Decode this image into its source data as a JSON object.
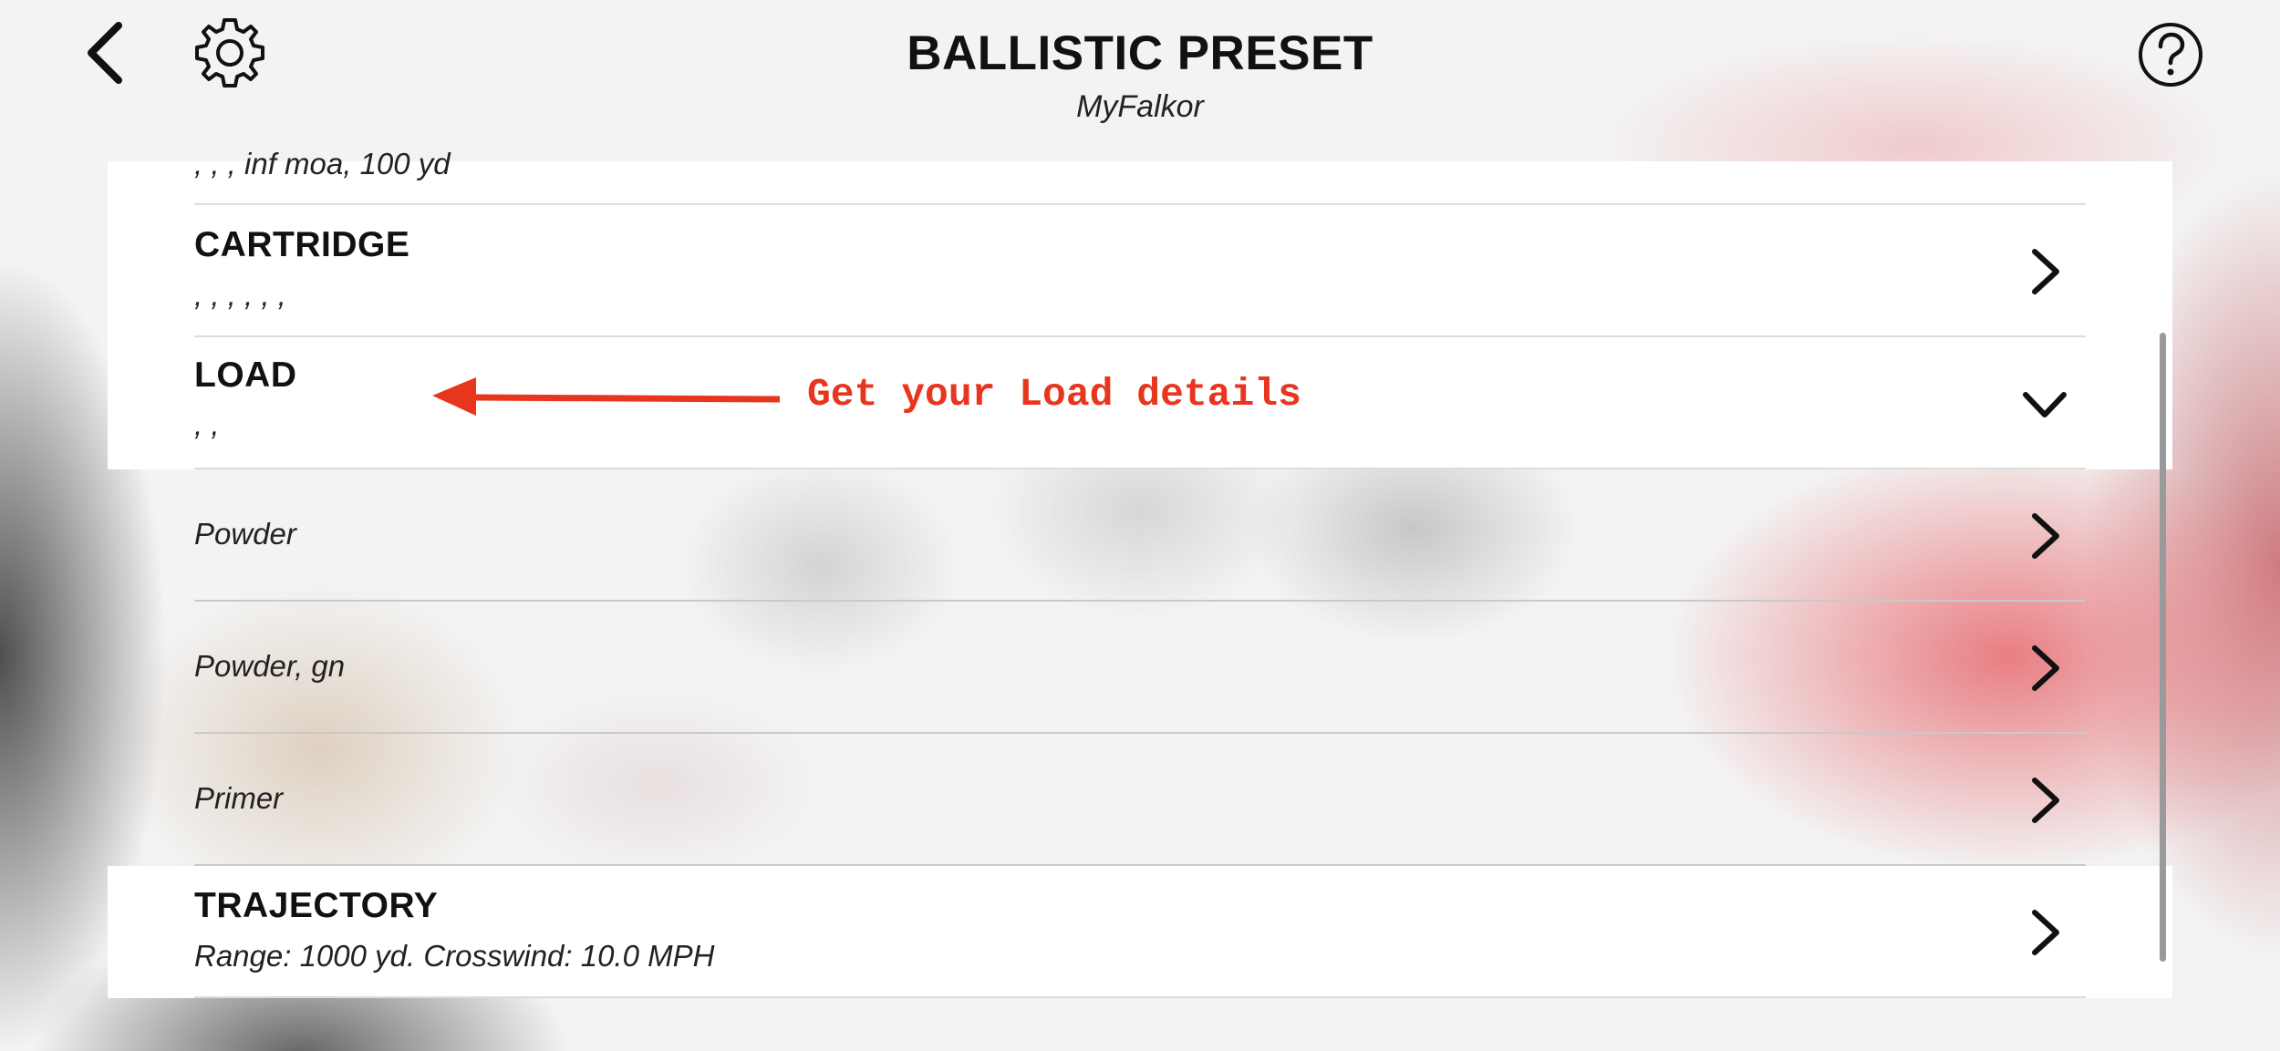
{
  "header": {
    "title": "BALLISTIC PRESET",
    "subtitle": "MyFalkor",
    "back_icon": "chevron-left-icon",
    "settings_icon": "gear-icon",
    "help_icon": "question-circle-icon"
  },
  "list": {
    "partial_row_sub": ", , , inf moa, 100 yd",
    "cartridge": {
      "heading": "CARTRIDGE",
      "sub": ", , , , , ,"
    },
    "load": {
      "heading": "LOAD",
      "sub": ", ,",
      "items": [
        "Powder",
        "Powder, gn",
        "Primer"
      ]
    },
    "trajectory": {
      "heading": "TRAJECTORY",
      "sub": "Range: 1000 yd. Crosswind: 10.0 MPH"
    }
  },
  "annotation": {
    "text": "Get your Load details",
    "color": "#e8361e"
  }
}
